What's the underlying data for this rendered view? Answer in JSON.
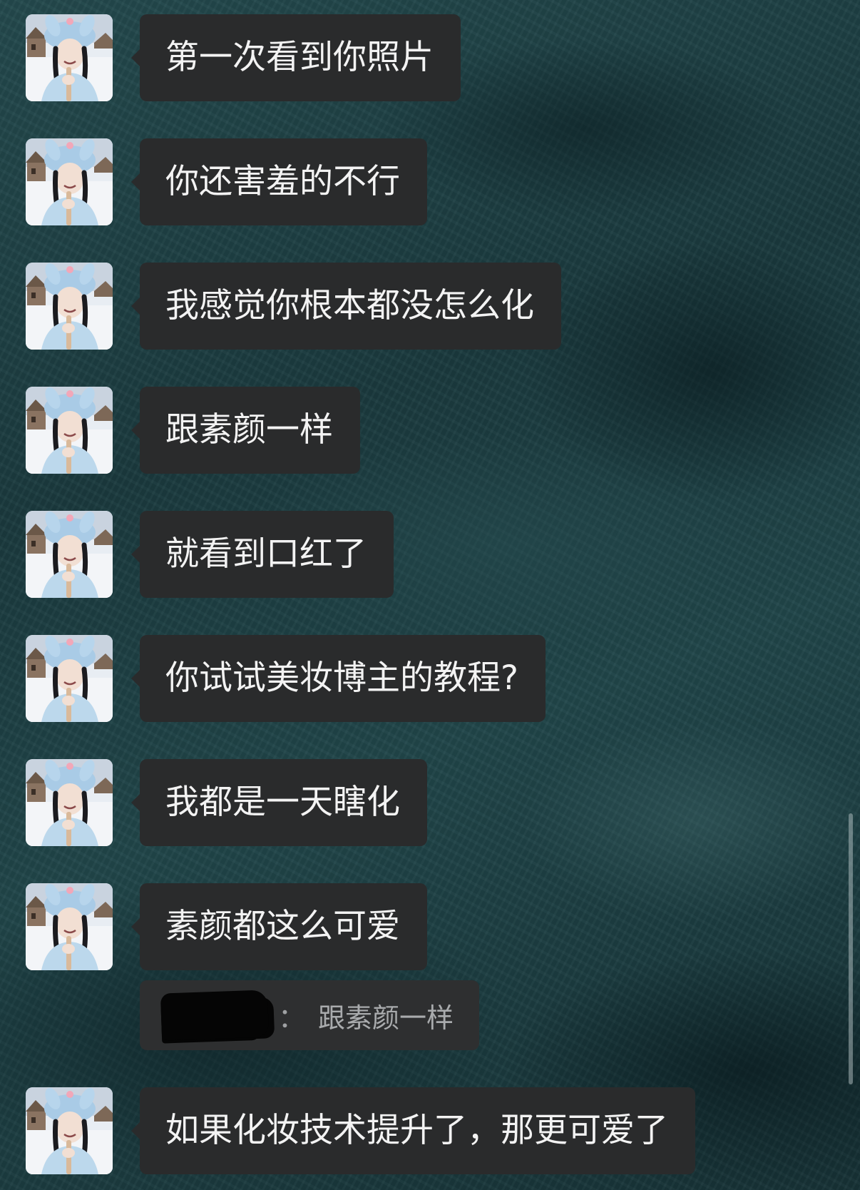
{
  "chat": {
    "messages": [
      {
        "text": "第一次看到你照片"
      },
      {
        "text": "你还害羞的不行"
      },
      {
        "text": "我感觉你根本都没怎么化"
      },
      {
        "text": "跟素颜一样"
      },
      {
        "text": "就看到口红了"
      },
      {
        "text": "你试试美妆博主的教程?"
      },
      {
        "text": "我都是一天瞎化"
      },
      {
        "text": "素颜都这么可爱"
      },
      {
        "text": "如果化妆技术提升了，那更可爱了"
      }
    ],
    "quote": {
      "separator": "：",
      "text": "跟素颜一样"
    }
  },
  "icons": {
    "avatar": "user-avatar-photo"
  },
  "colors": {
    "bubble": "#2a2b2c",
    "bubble_text": "#f3f3f3",
    "quote_text": "#a9abad",
    "background": "#1d3c40"
  }
}
